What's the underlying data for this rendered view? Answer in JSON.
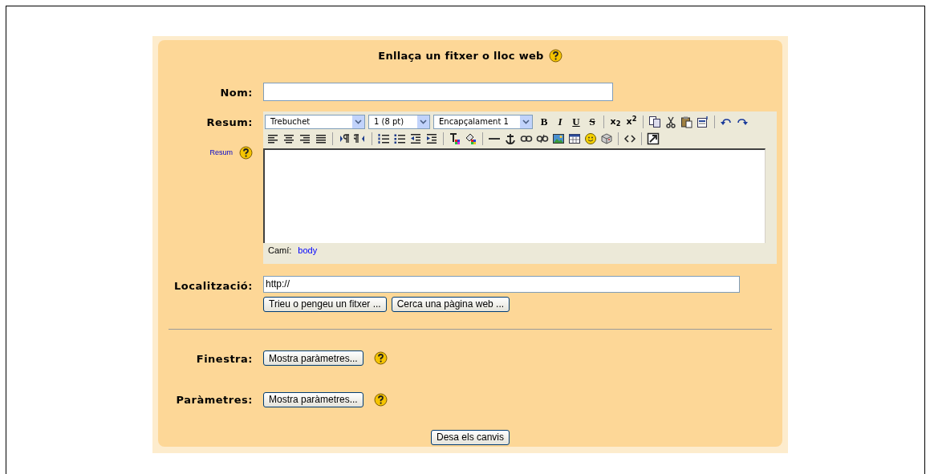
{
  "title": "Enllaça un fitxer o lloc web",
  "name_field": {
    "label": "Nom:"
  },
  "summary": {
    "label": "Resum:",
    "help_link": "Resum",
    "font": "Trebuchet",
    "size": "1 (8 pt)",
    "format": "Encapçalament 1",
    "format_buttons": [
      "B",
      "I",
      "U",
      "S"
    ],
    "script_buttons": [
      "x$_{2}$",
      "x$^{2}$"
    ],
    "path_label": "Camí:",
    "path": "body"
  },
  "location": {
    "label": "Localització:",
    "value": "http://",
    "buttons": [
      "Trieu o pengeu un fitxer ...",
      "Cerca una pàgina web ..."
    ]
  },
  "settings": [
    {
      "label": "Finestra:",
      "button": "Mostra paràmetres..."
    },
    {
      "label": "Paràmetres:",
      "button": "Mostra paràmetres..."
    }
  ],
  "submit": "Desa els canvis"
}
